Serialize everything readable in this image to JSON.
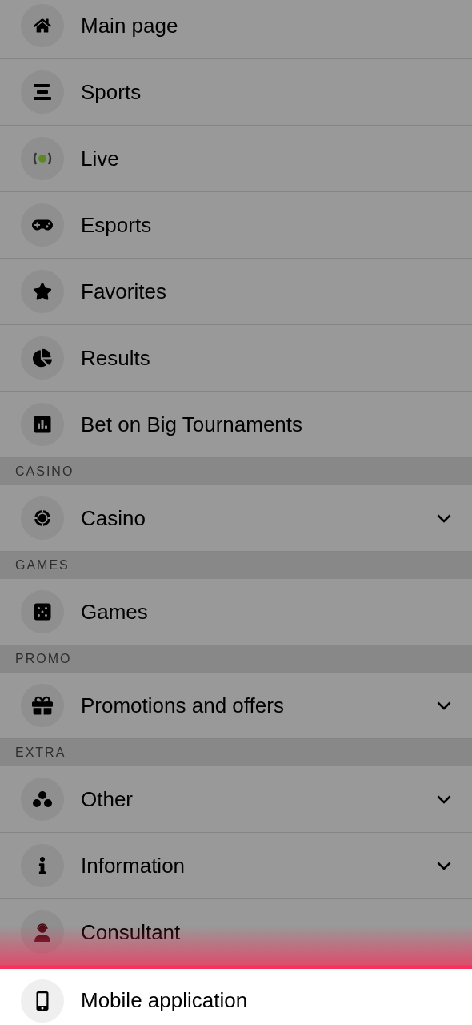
{
  "menu": [
    {
      "kind": "item",
      "label": "Main page",
      "expandable": false,
      "selected": false
    },
    {
      "kind": "item",
      "label": "Sports",
      "expandable": false,
      "selected": false
    },
    {
      "kind": "item",
      "label": "Live",
      "expandable": false,
      "selected": false
    },
    {
      "kind": "item",
      "label": "Esports",
      "expandable": false,
      "selected": false
    },
    {
      "kind": "item",
      "label": "Favorites",
      "expandable": false,
      "selected": false
    },
    {
      "kind": "item",
      "label": "Results",
      "expandable": false,
      "selected": false
    },
    {
      "kind": "item",
      "label": "Bet on Big Tournaments",
      "expandable": false,
      "selected": false
    },
    {
      "kind": "header",
      "label": "CASINO"
    },
    {
      "kind": "item",
      "label": "Casino",
      "expandable": true,
      "selected": false
    },
    {
      "kind": "header",
      "label": "GAMES"
    },
    {
      "kind": "item",
      "label": "Games",
      "expandable": false,
      "selected": false
    },
    {
      "kind": "header",
      "label": "PROMO"
    },
    {
      "kind": "item",
      "label": "Promotions and offers",
      "expandable": true,
      "selected": false
    },
    {
      "kind": "header",
      "label": "EXTRA"
    },
    {
      "kind": "item",
      "label": "Other",
      "expandable": true,
      "selected": false
    },
    {
      "kind": "item",
      "label": "Information",
      "expandable": true,
      "selected": false
    },
    {
      "kind": "item",
      "label": "Consultant",
      "expandable": false,
      "selected": false
    },
    {
      "kind": "item",
      "label": "Mobile application",
      "expandable": false,
      "selected": true
    }
  ]
}
